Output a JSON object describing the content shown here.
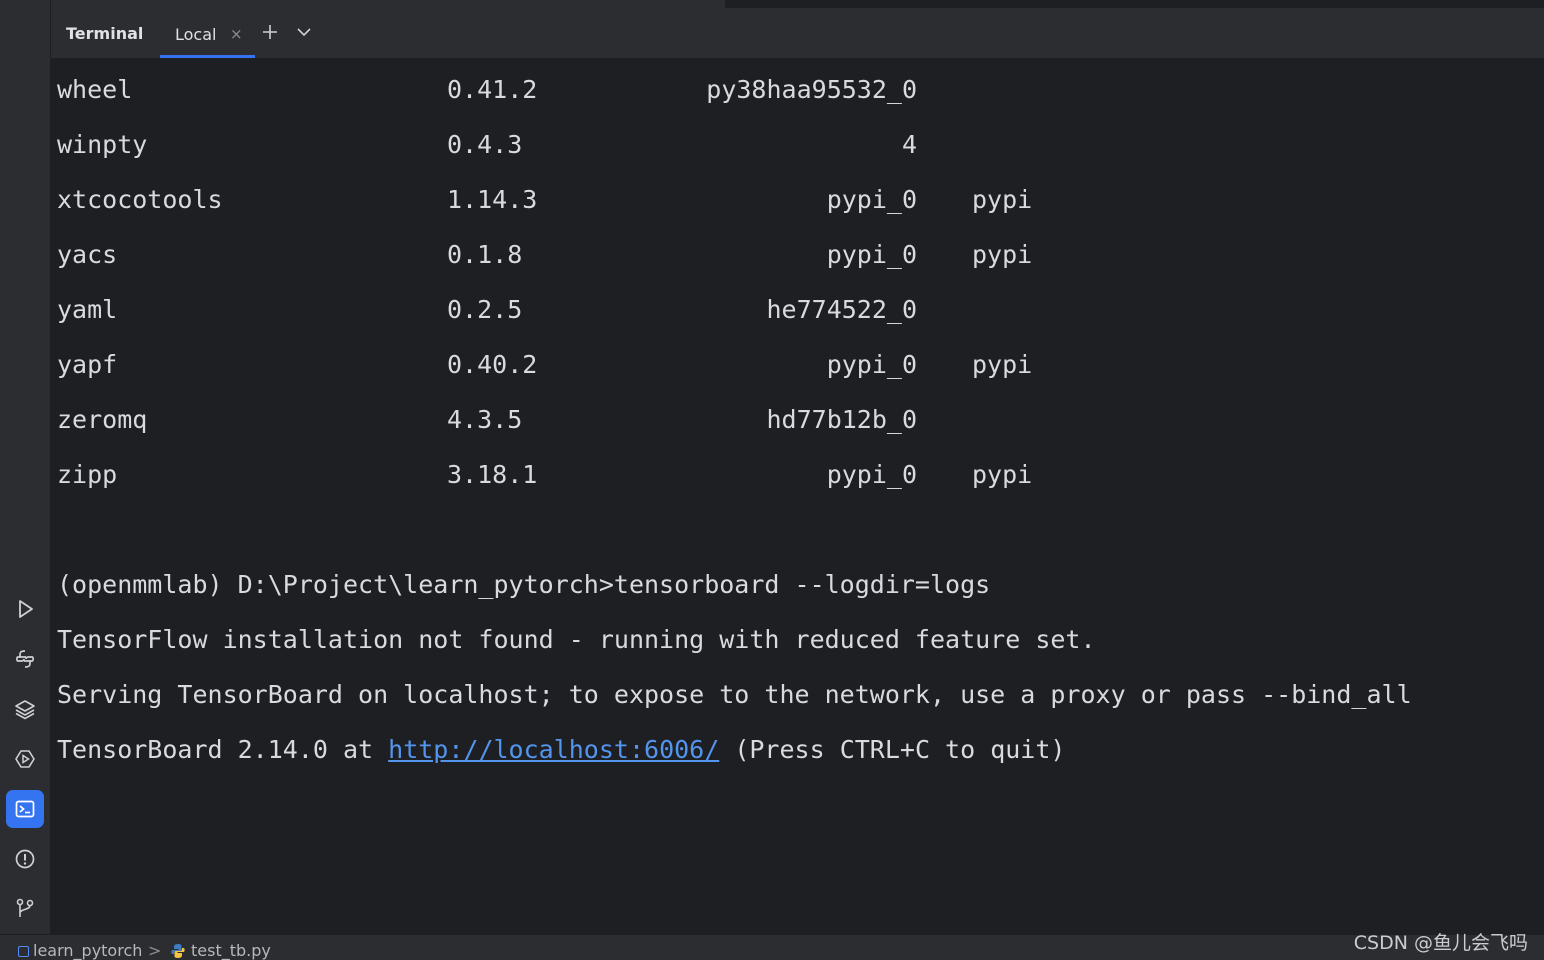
{
  "tool_window": {
    "title": "Terminal",
    "tabs": [
      {
        "label": "Local",
        "close": "×"
      }
    ],
    "new_tab_icon": "plus-icon",
    "tab_menu_icon": "chevron-down-icon"
  },
  "left_toolbar": {
    "icons": [
      "run-icon",
      "python-console-icon",
      "layers-icon",
      "services-icon",
      "terminal-icon",
      "problems-icon",
      "git-icon"
    ],
    "active": "terminal-icon",
    "accent": "#3574f0"
  },
  "packages": [
    {
      "name": "wheel",
      "version": "0.41.2",
      "build": "py38haa95532_0",
      "channel": ""
    },
    {
      "name": "winpty",
      "version": "0.4.3",
      "build": "4",
      "channel": ""
    },
    {
      "name": "xtcocotools",
      "version": "1.14.3",
      "build": "pypi_0",
      "channel": "pypi"
    },
    {
      "name": "yacs",
      "version": "0.1.8",
      "build": "pypi_0",
      "channel": "pypi"
    },
    {
      "name": "yaml",
      "version": "0.2.5",
      "build": "he774522_0",
      "channel": ""
    },
    {
      "name": "yapf",
      "version": "0.40.2",
      "build": "pypi_0",
      "channel": "pypi"
    },
    {
      "name": "zeromq",
      "version": "4.3.5",
      "build": "hd77b12b_0",
      "channel": ""
    },
    {
      "name": "zipp",
      "version": "3.18.1",
      "build": "pypi_0",
      "channel": "pypi"
    }
  ],
  "output": {
    "prompt": "(openmmlab) D:\\Project\\learn_pytorch>tensorboard --logdir=logs",
    "warning": "TensorFlow installation not found - running with reduced feature set.",
    "serving": "Serving TensorBoard on localhost; to expose to the network, use a proxy or pass --bind_all",
    "tb_prefix": "TensorBoard 2.14.0 at ",
    "tb_link": "http://localhost:6006/",
    "tb_suffix": " (Press CTRL+C to quit)"
  },
  "status_bar": {
    "project": "learn_pytorch",
    "separator": ">",
    "file": "test_tb.py"
  },
  "watermark": "CSDN @鱼儿会飞吗",
  "colors": {
    "link": "#5394ec",
    "background": "#1e1f22",
    "panel": "#2b2d30"
  }
}
